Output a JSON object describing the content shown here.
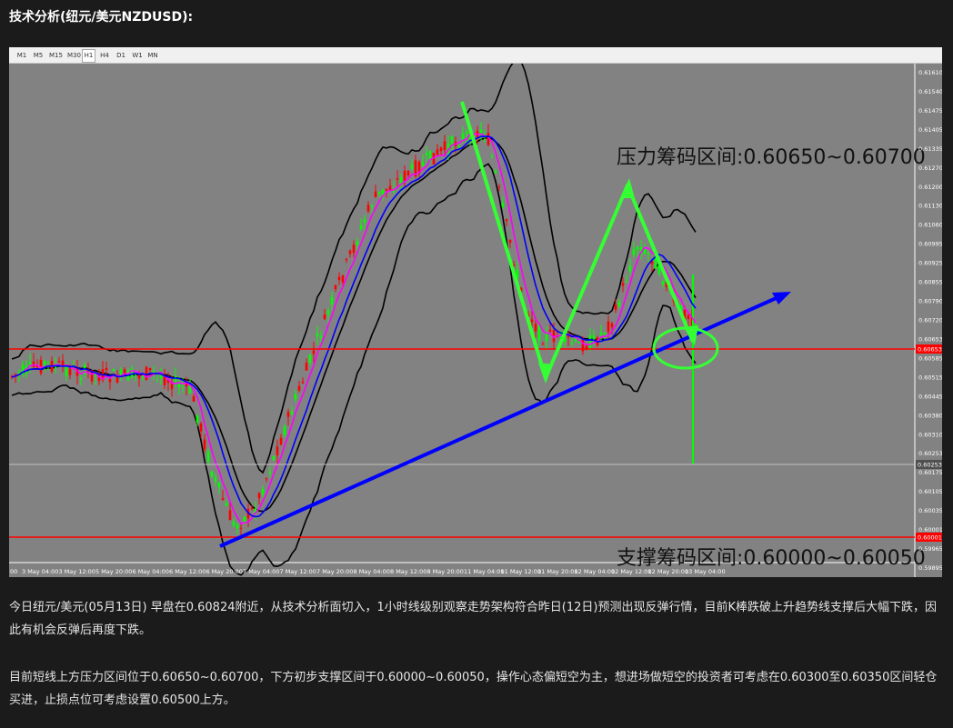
{
  "page": {
    "title": "技术分析(纽元/美元NZDUSD):"
  },
  "chart": {
    "toolbar": [
      "M1",
      "M5",
      "M15",
      "M30",
      "H1",
      "H4",
      "D1",
      "W1",
      "MN"
    ],
    "active_timeframe": "H1",
    "annotations": {
      "resistance": "压力筹码区间:0.60650~0.60700",
      "support": "支撑筹码区间:0.60000~0.60050"
    },
    "price_labels": [
      "0.61610",
      "0.61540",
      "0.61475",
      "0.61405",
      "0.61335",
      "0.61270",
      "0.61200",
      "0.61130",
      "0.61060",
      "0.60995",
      "0.60925",
      "0.60855",
      "0.60790",
      "0.60720",
      "0.60653",
      "0.60585",
      "0.60515",
      "0.60445",
      "0.60380",
      "0.60310",
      "0.60253",
      "0.60175",
      "0.60105",
      "0.60035",
      "0.60001",
      "0.59965",
      "0.59895"
    ],
    "time_labels": [
      "00",
      "3 May 04:00",
      "3 May 12:00",
      "5 May 20:00",
      "6 May 04:00",
      "6 May 12:00",
      "6 May 20:00",
      "7 May 04:00",
      "7 May 12:00",
      "7 May 20:00",
      "8 May 04:00",
      "8 May 12:00",
      "8 May 20:00",
      "11 May 04:00",
      "11 May 12:00",
      "11 May 20:00",
      "12 May 04:00",
      "12 May 12:00",
      "12 May 20:00",
      "13 May 04:00"
    ],
    "level_markers": {
      "red_upper": "0.60653",
      "current": "0.60253",
      "red_lower": "0.60001"
    },
    "colors": {
      "background": "#828282",
      "bull_candle": "#00ff00",
      "bear_candle": "#ff0000",
      "bollinger": "#000000",
      "ma_fast": "#ff00ff",
      "ma_slow": "#0000ff",
      "trendline": "#0000ff",
      "annotation_arrows": "#33ff33",
      "level_lines": "#ff0000"
    }
  },
  "paragraphs": [
    "今日纽元/美元(05月13日) 早盘在0.60824附近，从技术分析面切入，1小时线级别观察走势架构符合昨日(12日)预测出现反弹行情，目前K棒跌破上升趋势线支撑后大幅下跌，因此有机会反弹后再度下跌。",
    "目前短线上方压力区间位于0.60650~0.60700，下方初步支撑区间于0.60000~0.60050，操作心态偏短空为主，想进场做短空的投资者可考虑在0.60300至0.60350区间轻仓买进，止损点位可考虑设置0.60500上方。"
  ]
}
